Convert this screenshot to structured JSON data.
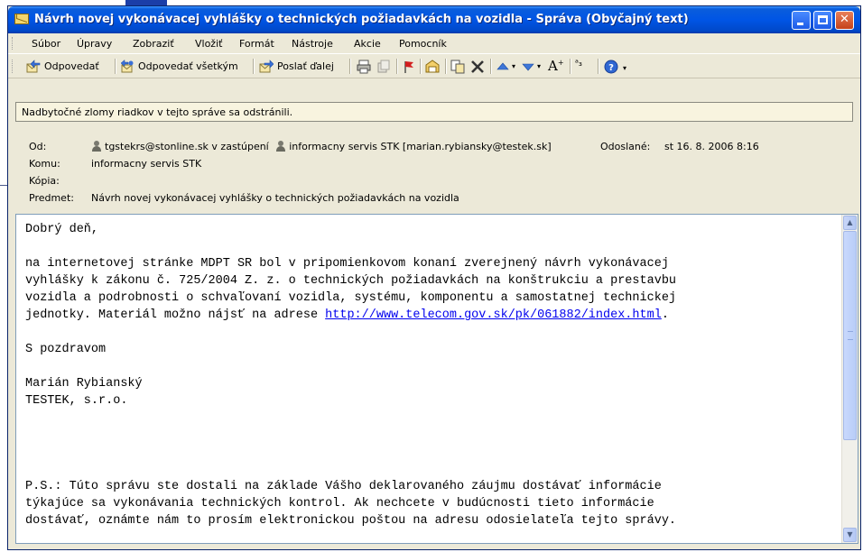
{
  "window": {
    "title": "Návrh novej vykonávacej vyhlášky o technických požiadavkách na vozidla - Správa (Obyčajný text)"
  },
  "menu": {
    "items": [
      "Súbor",
      "Úpravy",
      "Zobraziť",
      "Vložiť",
      "Formát",
      "Nástroje",
      "Akcie",
      "Pomocník"
    ]
  },
  "toolbar": {
    "reply": "Odpovedať",
    "reply_all": "Odpovedať všetkým",
    "forward": "Poslať ďalej"
  },
  "infobar": {
    "text": "Nadbytočné zlomy riadkov v tejto správe sa odstránili."
  },
  "headers": {
    "from_label": "Od:",
    "from_sender": "tgstekrs@stonline.sk v zastúpení",
    "from_on_behalf": "informacny servis STK [marian.rybiansky@testek.sk]",
    "sent_label": "Odoslané:",
    "sent_value": "st 16. 8. 2006 8:16",
    "to_label": "Komu:",
    "to_value": "informacny servis STK",
    "cc_label": "Kópia:",
    "cc_value": "",
    "subject_label": "Predmet:",
    "subject_value": "Návrh novej vykonávacej vyhlášky o technických požiadavkách na vozidla"
  },
  "message": {
    "greeting": "Dobrý deň,",
    "para1": "na internetovej stránke MDPT SR bol v pripomienkovom konaní zverejnený návrh vykonávacej\nvyhlášky k zákonu č. 725/2004 Z. z. o technických požiadavkách na konštrukciu a prestavbu\nvozidla a podrobnosti o schvaľovaní vozidla, systému, komponentu a samostatnej technickej\njednotky. Materiál možno nájsť na adrese ",
    "link": "http://www.telecom.gov.sk/pk/061882/index.html",
    "para1_end": ".",
    "closing": "S pozdravom",
    "signature_name": "Marián Rybianský",
    "signature_company": "TESTEK, s.r.o.",
    "ps": "P.S.: Túto správu ste dostali na základe Vášho deklarovaného záujmu dostávať informácie\ntýkajúce sa vykonávania technických kontrol. Ak nechcete v budúcnosti tieto informácie\ndostávať, oznámte nám to prosím elektronickou poštou na adresu odosielateľa tejto správy."
  },
  "icons": {
    "title": "envelope-icon",
    "reply": "reply-icon",
    "reply_all": "reply-all-icon",
    "forward": "forward-icon",
    "print": "print-icon",
    "move": "move-icon",
    "flag": "flag-icon",
    "address_book": "address-book-icon",
    "copy": "copy-icon",
    "delete": "delete-icon",
    "previous": "previous-icon",
    "next": "next-icon",
    "font_size": "font-size-icon",
    "encoding": "encoding-icon",
    "help": "help-icon"
  }
}
